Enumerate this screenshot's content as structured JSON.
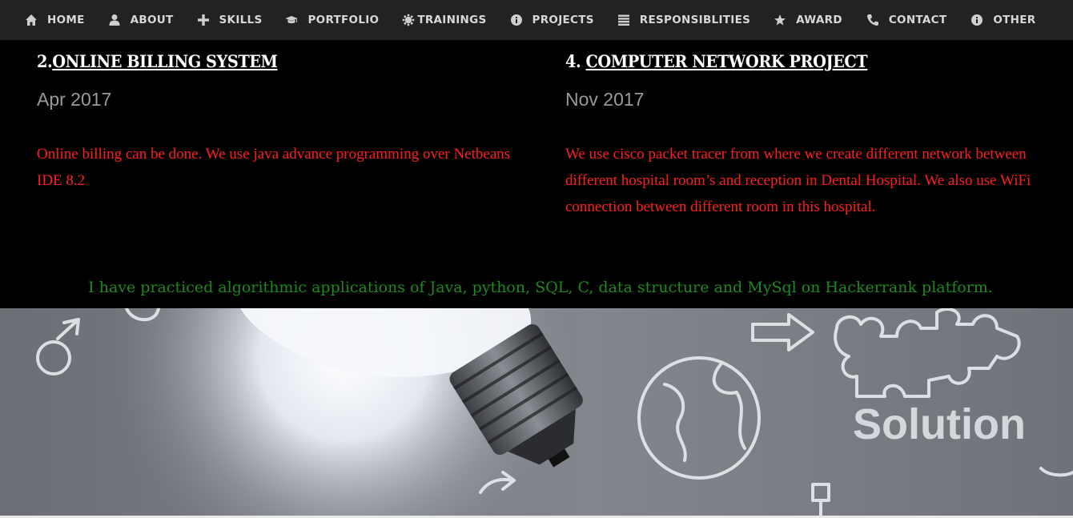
{
  "nav": {
    "items": [
      {
        "label": "HOME",
        "icon": "home-icon"
      },
      {
        "label": "ABOUT",
        "icon": "user-icon"
      },
      {
        "label": "SKILLS",
        "icon": "plus-icon"
      },
      {
        "label": "PORTFOLIO",
        "icon": "graduation-cap-icon"
      },
      {
        "label": "TRAININGS",
        "icon": "certificate-icon"
      },
      {
        "label": "PROJECTS",
        "icon": "info-circle-icon"
      },
      {
        "label": "RESPONSIBLITIES",
        "icon": "list-icon"
      },
      {
        "label": "AWARD",
        "icon": "star-icon"
      },
      {
        "label": "CONTACT",
        "icon": "phone-icon"
      },
      {
        "label": "OTHER",
        "icon": "info-circle-icon"
      }
    ]
  },
  "projects": {
    "left": {
      "number": "2.",
      "title": "ONLINE BILLING SYSTEM",
      "date": "Apr 2017",
      "description": "Online billing can be done. We use java advance programming over Netbeans IDE 8.2"
    },
    "right": {
      "number": "4. ",
      "title": "COMPUTER NETWORK PROJECT",
      "date": "Nov 2017",
      "description": "We use cisco packet tracer from where we create different network between different hospital room’s and reception in Dental Hospital. We also use WiFi connection between different room in this hospital."
    }
  },
  "hackerrank_text": "I have practiced algorithmic applications of Java, python, SQL, C, data structure and MySql on Hackerrank platform.",
  "hero": {
    "chalk_word": "Solution"
  },
  "colors": {
    "nav_bg": "#222222",
    "nav_text": "#d8d8d8",
    "description_red": "#ff1e1e",
    "hackerrank_green": "#1d8a1d",
    "date_gray": "#9a9a9a"
  }
}
